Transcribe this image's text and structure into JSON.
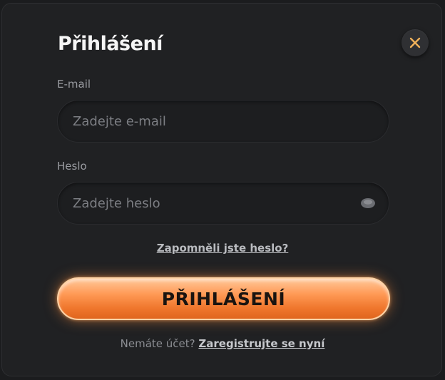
{
  "dialog": {
    "title": "Přihlášení",
    "close_icon": "close-icon",
    "accent_color": "#f28a3c"
  },
  "email": {
    "label": "E-mail",
    "placeholder": "Zadejte e-mail",
    "value": ""
  },
  "password": {
    "label": "Heslo",
    "placeholder": "Zadejte heslo",
    "value": "",
    "toggle_icon": "eye-icon"
  },
  "forgot": {
    "label": "Zapomněli jste heslo?"
  },
  "submit": {
    "label": "PŘIHLÁŠENÍ"
  },
  "register": {
    "prompt": "Nemáte účet?",
    "link_label": "Zaregistrujte se nyní"
  }
}
